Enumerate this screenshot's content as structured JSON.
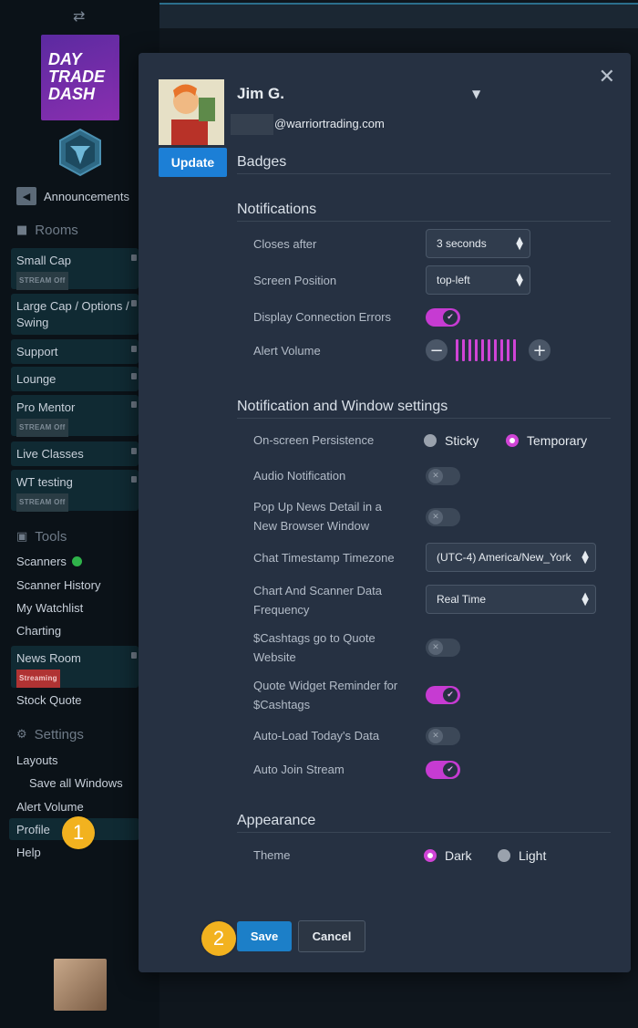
{
  "sidebar": {
    "logo_text": [
      "DAY",
      "TRADE",
      "DASH"
    ],
    "announcements": "Announcements",
    "rooms_header": "Rooms",
    "rooms": [
      {
        "label": "Small Cap",
        "tag": "STREAM Off"
      },
      {
        "label": "Large Cap / Options / Swing",
        "tag": ""
      },
      {
        "label": "Support",
        "tag": ""
      },
      {
        "label": "Lounge",
        "tag": ""
      },
      {
        "label": "Pro Mentor",
        "tag": "STREAM Off"
      },
      {
        "label": "Live Classes",
        "tag": ""
      },
      {
        "label": "WT testing",
        "tag": "STREAM Off"
      }
    ],
    "tools_header": "Tools",
    "tools": [
      "Scanners",
      "Scanner History",
      "My Watchlist",
      "Charting"
    ],
    "news_room": {
      "label": "News Room",
      "tag": "Streaming"
    },
    "stock_quote": "Stock Quote",
    "settings_header": "Settings",
    "settings": [
      "Layouts",
      "Save all Windows",
      "Alert Volume",
      "Profile",
      "Help"
    ]
  },
  "step_badges": [
    "1",
    "2"
  ],
  "profile": {
    "name": "Jim G.",
    "email_domain": "@warriortrading.com",
    "update_label": "Update",
    "badges_title": "Badges",
    "notifications": {
      "title": "Notifications",
      "closes_after_label": "Closes after",
      "closes_after_value": "3 seconds",
      "screen_position_label": "Screen Position",
      "screen_position_value": "top-left",
      "display_errors_label": "Display Connection Errors",
      "display_errors_on": true,
      "alert_volume_label": "Alert Volume",
      "alert_volume_level": 1.0
    },
    "window_settings": {
      "title": "Notification and Window settings",
      "persistence_label": "On-screen Persistence",
      "persistence_options": [
        "Sticky",
        "Temporary"
      ],
      "persistence_selected": "Temporary",
      "audio_label": "Audio Notification",
      "audio_on": false,
      "popup_label_1": "Pop Up News Detail in a",
      "popup_label_2": "New Browser Window",
      "popup_on": false,
      "tz_label": "Chat Timestamp Timezone",
      "tz_value": "(UTC-4) America/New_York",
      "freq_label_1": "Chart And Scanner Data",
      "freq_label_2": "Frequency",
      "freq_value": "Real Time",
      "cashtags_label_1": "$Cashtags go to Quote",
      "cashtags_label_2": "Website",
      "cashtags_on": false,
      "quote_label_1": "Quote Widget Reminder for",
      "quote_label_2": "$Cashtags",
      "quote_on": true,
      "autoload_label": "Auto-Load Today's Data",
      "autoload_on": false,
      "autojoin_label": "Auto Join Stream",
      "autojoin_on": true
    },
    "appearance": {
      "title": "Appearance",
      "theme_label": "Theme",
      "theme_options": [
        "Dark",
        "Light"
      ],
      "theme_selected": "Dark"
    },
    "save_label": "Save",
    "cancel_label": "Cancel"
  },
  "colors": {
    "accent_pink": "#d044d6",
    "button_blue": "#1c7fd6",
    "step_badge": "#f2b21f",
    "online_green": "#2fb34a"
  },
  "icons": [
    "swap-arrows-icon",
    "megaphone-icon",
    "chat-icon",
    "briefcase-icon",
    "gear-icon",
    "close-icon",
    "chevron-down-icon"
  ]
}
